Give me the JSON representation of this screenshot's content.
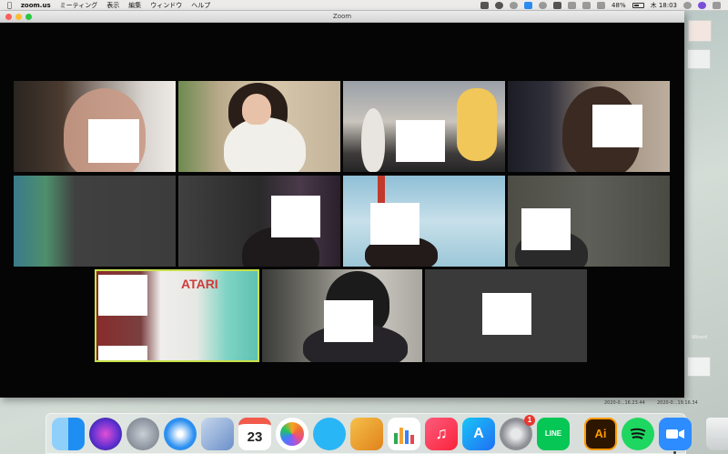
{
  "menubar": {
    "apple": "",
    "app_name": "zoom.us",
    "menus": [
      "ミーティング",
      "表示",
      "編集",
      "ウィンドウ",
      "ヘルプ"
    ],
    "battery": "48%",
    "clock": "木 18:03"
  },
  "window": {
    "title": "Zoom"
  },
  "tiles": [
    {
      "label": "ATARI"
    }
  ],
  "desktop": {
    "screenshot_1": "2020-0...16.23.44",
    "screenshot_2": "2020-0...19.16.34",
    "wizard_label": "Wizard"
  },
  "dock": {
    "apps": [
      {
        "name": "Finder",
        "icon": "finder-icon",
        "color": "#1e8ef2"
      },
      {
        "name": "Siri",
        "icon": "siri-icon",
        "color": "#5a2fd0"
      },
      {
        "name": "Launchpad",
        "icon": "launchpad-icon",
        "color": "#9aa3ad"
      },
      {
        "name": "Safari",
        "icon": "safari-icon",
        "color": "#2b8ff0"
      },
      {
        "name": "Preview",
        "icon": "preview-icon",
        "color": "#6a8fc9"
      },
      {
        "name": "Calendar",
        "icon": "calendar-icon",
        "color": "#ffffff",
        "text": "23"
      },
      {
        "name": "Photos",
        "icon": "photos-icon",
        "color": "#ffffff"
      },
      {
        "name": "Messages",
        "icon": "messages-icon",
        "color": "#28b6f6"
      },
      {
        "name": "Pages",
        "icon": "pages-icon",
        "color": "#f0a020"
      },
      {
        "name": "Numbers",
        "icon": "numbers-icon",
        "color": "#ffffff"
      },
      {
        "name": "Music",
        "icon": "music-icon",
        "color": "#fc3c5a"
      },
      {
        "name": "App Store",
        "icon": "app-store-icon",
        "color": "#1f8bf3"
      },
      {
        "name": "System Preferences",
        "icon": "system-preferences-icon",
        "color": "#8d8f94",
        "badge": "1"
      },
      {
        "name": "LINE",
        "icon": "line-icon",
        "color": "#06c755",
        "text": "LINE"
      },
      {
        "name": "Illustrator",
        "icon": "illustrator-icon",
        "color": "#2d1600",
        "text": "Ai"
      },
      {
        "name": "Spotify",
        "icon": "spotify-icon",
        "color": "#1ed760"
      },
      {
        "name": "Zoom",
        "icon": "zoom-icon",
        "color": "#2d8cff"
      },
      {
        "name": "Trash",
        "icon": "trash-icon",
        "color": "#dfe3e3"
      }
    ]
  }
}
